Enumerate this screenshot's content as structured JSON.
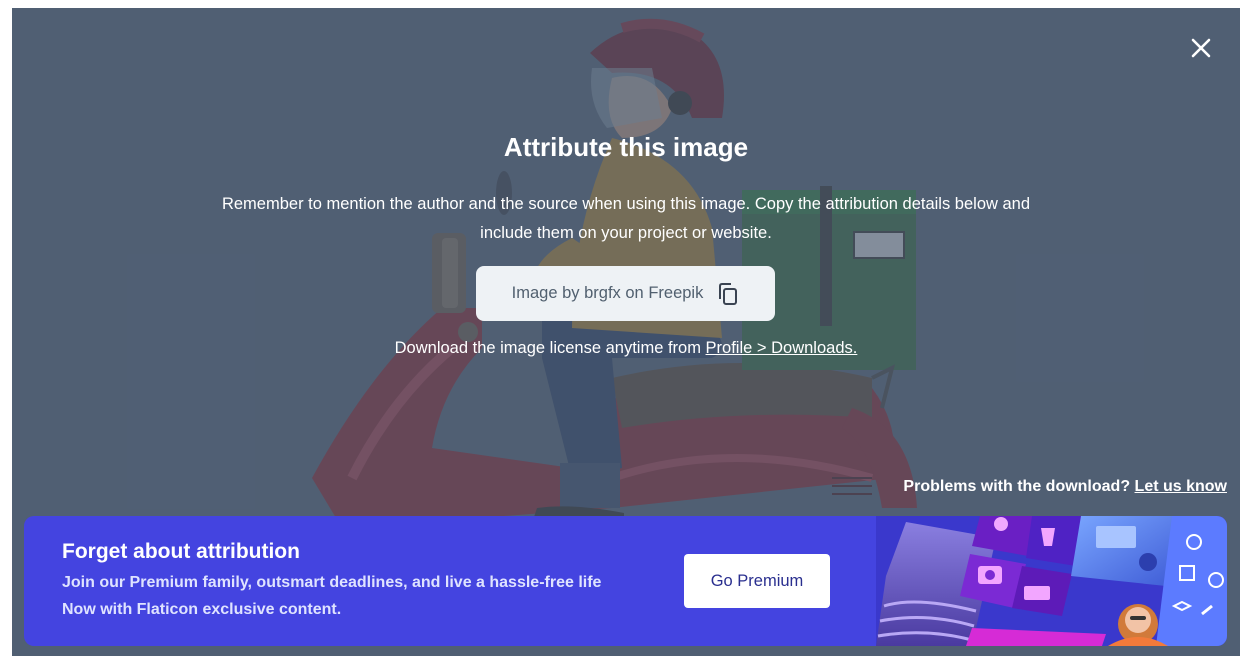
{
  "modal": {
    "title": "Attribute this image",
    "description": "Remember to mention the author and the source when using this image. Copy the attribution details below and include them on your project or website.",
    "attribution_text": "Image by brgfx on Freepik",
    "license_prefix": "Download the image license anytime from ",
    "license_link": "Profile > Downloads."
  },
  "problems": {
    "text": "Problems with the download? ",
    "link": "Let us know"
  },
  "banner": {
    "title": "Forget about attribution",
    "line1": "Join our Premium family, outsmart deadlines, and live a hassle-free life",
    "line2": "Now with Flaticon exclusive content.",
    "button_label": "Go Premium"
  },
  "colors": {
    "overlay_bg": "#56657a",
    "banner_bg": "#4444e0",
    "copy_box_bg": "#eef2f5",
    "button_text": "#2a2f8f"
  },
  "icons": [
    "close-icon",
    "copy-icon"
  ]
}
